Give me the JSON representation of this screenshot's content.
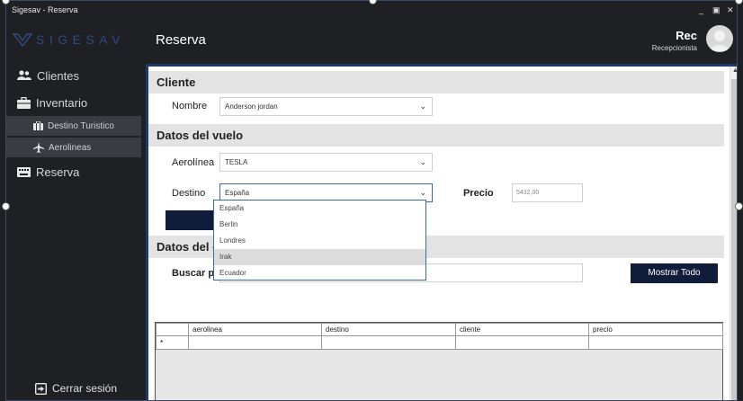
{
  "window": {
    "title": "Sigesav - Reserva",
    "controls": {
      "minimize": "_",
      "maximize": "▣",
      "close": "✕"
    }
  },
  "header": {
    "logo_text": "SIGESAV",
    "page_title": "Reserva",
    "user_name": "Rec",
    "user_role": "Recepcionista"
  },
  "sidebar": {
    "items": [
      {
        "label": "Clientes",
        "icon": "users-icon"
      },
      {
        "label": "Inventario",
        "icon": "briefcase-icon"
      },
      {
        "label": "Reserva",
        "icon": "keyboard-icon"
      }
    ],
    "subitems": [
      {
        "label": "Destino Turistico",
        "icon": "suitcase-icon"
      },
      {
        "label": "Aerolineas",
        "icon": "plane-icon"
      }
    ],
    "logout_label": "Cerrar sesión"
  },
  "form": {
    "cliente_section": "Cliente",
    "nombre_label": "Nombre",
    "nombre_value": "Anderson jordan",
    "vuelo_section": "Datos del vuelo",
    "aerolinea_label": "Aerolínea",
    "aerolinea_value": "TESLA",
    "destino_label": "Destino",
    "destino_value": "España",
    "precio_label": "Precio",
    "precio_value": "5432,00",
    "reservar_button_partial": "R",
    "clientes_section_partial": "Datos del cl",
    "buscar_label_partial": "Buscar por",
    "mostrar_button": "Mostrar Todo"
  },
  "destino_options": [
    "España",
    "Berlin",
    "Londres",
    "Irak",
    "Ecuador"
  ],
  "destino_highlighted": "Irak",
  "grid": {
    "columns": [
      "aerolinea",
      "destino",
      "cliente",
      "precio"
    ],
    "new_row_marker": "*"
  },
  "colors": {
    "window_bg": "#1f2024",
    "sidebar_sub_bg": "#3a3c42",
    "accent_dark": "#0f1d3a",
    "frame_blue": "#1d3a6e",
    "section_bg": "#e3e3e3"
  }
}
